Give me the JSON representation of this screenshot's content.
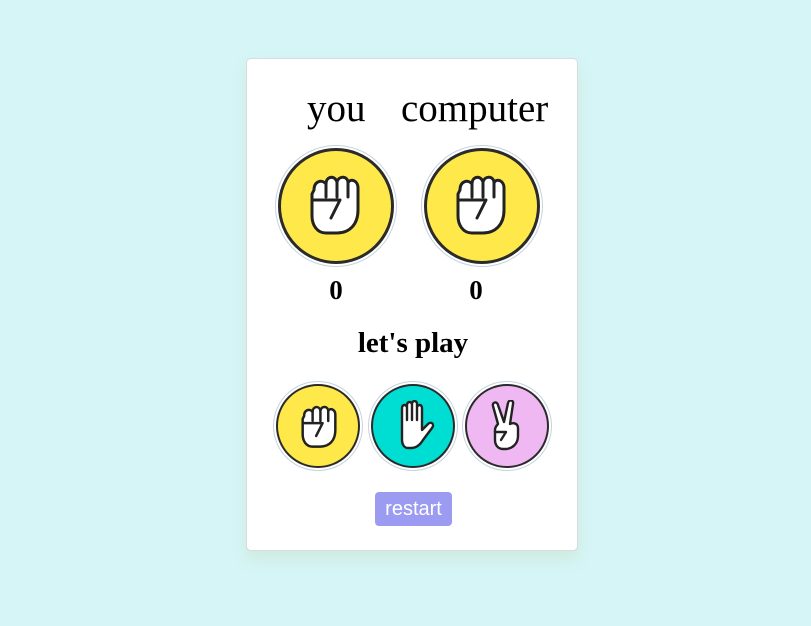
{
  "players": {
    "you_label": "you",
    "computer_label": "computer"
  },
  "hands": {
    "you": {
      "icon": "fist-icon",
      "color": "#ffe94a"
    },
    "computer": {
      "icon": "fist-icon",
      "color": "#ffe94a"
    }
  },
  "scores": {
    "you": "0",
    "computer": "0"
  },
  "status_text": "let's play",
  "choices": [
    {
      "name": "rock",
      "icon": "fist-icon",
      "color": "#ffe94a"
    },
    {
      "name": "paper",
      "icon": "open-palm-icon",
      "color": "#00ded4"
    },
    {
      "name": "scissors",
      "icon": "peace-sign-icon",
      "color": "#f0b8f2"
    }
  ],
  "restart_label": "restart",
  "colors": {
    "background": "#d5f5f7",
    "card": "#ffffff",
    "restart_button": "#9b9bf1"
  }
}
